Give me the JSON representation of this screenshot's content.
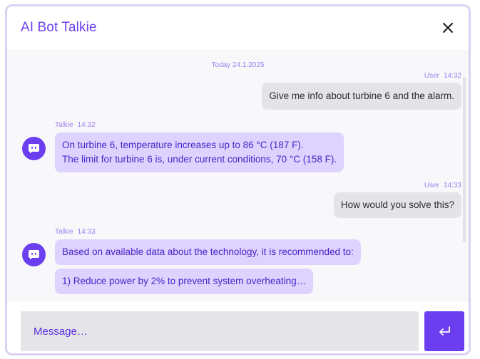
{
  "header": {
    "title": "AI Bot Talkie"
  },
  "chat": {
    "date": "Today 24.1.2025",
    "messages": [
      {
        "sender": "User",
        "time": "14:32",
        "lines": [
          "Give me info about turbine 6 and the alarm."
        ]
      },
      {
        "sender": "Talkie",
        "time": "14:32",
        "lines": [
          "On turbine 6, temperature increases up to 86 °C (187 F).",
          "The limit for turbine 6 is, under current conditions, 70 °C (158 F)."
        ]
      },
      {
        "sender": "User",
        "time": "14:33",
        "lines": [
          "How would you solve this?"
        ]
      },
      {
        "sender": "Talkie",
        "time": "14:33",
        "lines": [
          "Based on available data about the technology, it is recommended to:",
          "1) Reduce power by 2% to prevent system overheating…"
        ]
      }
    ]
  },
  "composer": {
    "placeholder": "Message…"
  },
  "icons": {
    "close": "close-icon",
    "bot": "bot-icon",
    "send": "enter-arrow-icon"
  },
  "colors": {
    "accent": "#6b3ff0",
    "bot_bubble": "#ddd3fe",
    "user_bubble": "#e4e4e8",
    "frame": "#d9d2f3"
  }
}
